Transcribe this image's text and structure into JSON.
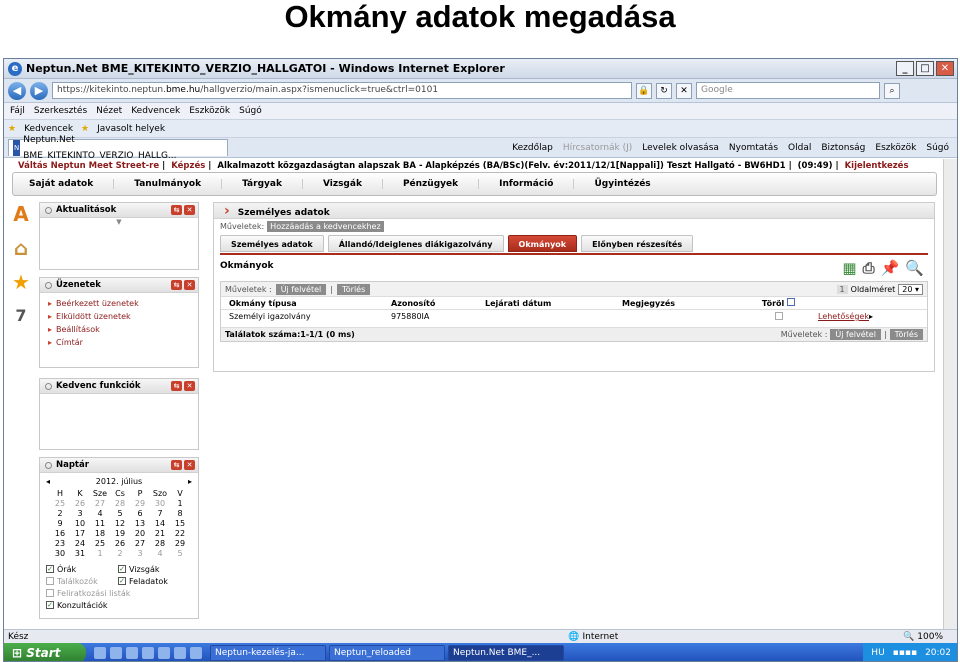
{
  "slide_title": "Okmány adatok megadása",
  "window": {
    "title": "Neptun.Net BME_KITEKINTO_VERZIO_HALLGATOI - Windows Internet Explorer",
    "url_prefix": "https://kitekinto.neptun.",
    "url_domain": "bme.hu",
    "url_suffix": "/hallgverzio/main.aspx?ismenuclick=true&ctrl=0101",
    "search_placeholder": "Google",
    "menu": [
      "Fájl",
      "Szerkesztés",
      "Nézet",
      "Kedvencek",
      "Eszközök",
      "Súgó"
    ],
    "favorites": "Kedvencek",
    "suggested": "Javasolt helyek",
    "tab_label": "Neptun.Net BME_KITEKINTO_VERZIO_HALLG...",
    "commands": {
      "home": "Kezdőlap",
      "feeds": "Hírcsatornák (J)",
      "mail": "Levelek olvasása",
      "print": "Nyomtatás",
      "page": "Oldal",
      "safety": "Biztonság",
      "tools": "Eszközök",
      "help": "Súgó"
    }
  },
  "infoline": {
    "switch": "Váltás Neptun Meet Street-re",
    "training": "Képzés",
    "program": "Alkalmazott közgazdaságtan alapszak BA - Alapképzés (BA/BSc)(Felv. év:2011/12/1[Nappali]) Teszt Hallgató - BW6HD1",
    "time": "(09:49)",
    "logout": "Kijelentkezés"
  },
  "mainmenu": [
    "Saját adatok",
    "Tanulmányok",
    "Tárgyak",
    "Vizsgák",
    "Pénzügyek",
    "Információ",
    "Ügyintézés"
  ],
  "panels": {
    "news": "Aktualitások",
    "messages": {
      "title": "Üzenetek",
      "items": [
        "Beérkezett üzenetek",
        "Elküldött üzenetek",
        "Beállítások",
        "Címtár"
      ]
    },
    "favorites": "Kedvenc funkciók",
    "calendar": {
      "title": "Naptár",
      "month": "2012. július",
      "prev": "◂",
      "next": "▸",
      "weekdays": [
        "H",
        "K",
        "Sze",
        "Cs",
        "P",
        "Szo",
        "V"
      ],
      "days": [
        [
          "25",
          "26",
          "27",
          "28",
          "29",
          "30",
          "1"
        ],
        [
          "2",
          "3",
          "4",
          "5",
          "6",
          "7",
          "8"
        ],
        [
          "9",
          "10",
          "11",
          "12",
          "13",
          "14",
          "15"
        ],
        [
          "16",
          "17",
          "18",
          "19",
          "20",
          "21",
          "22"
        ],
        [
          "23",
          "24",
          "25",
          "26",
          "27",
          "28",
          "29"
        ],
        [
          "30",
          "31",
          "1",
          "2",
          "3",
          "4",
          "5"
        ]
      ],
      "checks": {
        "classes": "Órák",
        "exams": "Vizsgák",
        "meetings": "Találkozók",
        "tasks": "Feladatok",
        "enrollment": "Feliratkozási listák",
        "consultations": "Konzultációk"
      }
    }
  },
  "main": {
    "header": "Személyes adatok",
    "ops_label": "Műveletek:",
    "ops_add_fav": "Hozzáadás a kedvencekhez",
    "tabs": [
      "Személyes adatok",
      "Állandó/Ideiglenes diákigazolvány",
      "Okmányok",
      "Előnyben részesítés"
    ],
    "section": "Okmányok",
    "grid": {
      "ops_label": "Műveletek :",
      "new_btn": "Új felvétel",
      "delete_btn": "Törlés",
      "page_num": "1",
      "page_size_label": "Oldalméret",
      "page_size": "20",
      "columns": [
        "Okmány típusa",
        "Azonosító",
        "Lejárati dátum",
        "Megjegyzés",
        "Töröl"
      ],
      "rows": [
        {
          "type": "Személyi igazolvány",
          "id": "975880IA",
          "expiry": "",
          "note": "",
          "action": "Lehetőségek"
        }
      ],
      "footer": "Találatok száma:1-1/1 (0 ms)"
    }
  },
  "status": {
    "left": "Kész",
    "zone": "Internet",
    "zoom": "100%"
  },
  "taskbar": {
    "start": "Start",
    "items": [
      "Neptun-kezelés-ja...",
      "Neptun_reloaded",
      "Neptun.Net BME_..."
    ],
    "lang": "HU",
    "clock": "20:02"
  }
}
